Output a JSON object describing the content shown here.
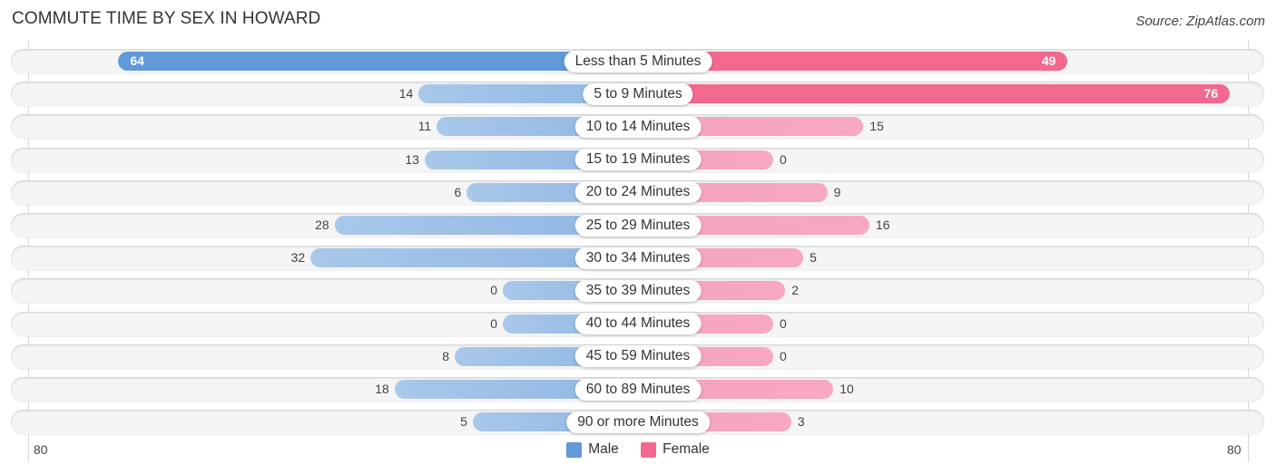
{
  "title": "COMMUTE TIME BY SEX IN HOWARD",
  "source": "Source: ZipAtlas.com",
  "colors": {
    "male": "#6199d9",
    "female": "#f2688f"
  },
  "chart_data": {
    "type": "bar",
    "orientation": "horizontal-diverging",
    "title": "COMMUTE TIME BY SEX IN HOWARD",
    "categories": [
      "Less than 5 Minutes",
      "5 to 9 Minutes",
      "10 to 14 Minutes",
      "15 to 19 Minutes",
      "20 to 24 Minutes",
      "25 to 29 Minutes",
      "30 to 34 Minutes",
      "35 to 39 Minutes",
      "40 to 44 Minutes",
      "45 to 59 Minutes",
      "60 to 89 Minutes",
      "90 or more Minutes"
    ],
    "series": [
      {
        "name": "Male",
        "values": [
          64,
          14,
          11,
          13,
          6,
          28,
          32,
          0,
          0,
          8,
          18,
          5
        ]
      },
      {
        "name": "Female",
        "values": [
          49,
          76,
          15,
          0,
          9,
          16,
          5,
          2,
          0,
          0,
          10,
          3
        ]
      }
    ],
    "axis": {
      "left_label": "80",
      "right_label": "80",
      "range": [
        -80,
        80
      ]
    },
    "legend": {
      "position": "bottom-center",
      "entries": [
        "Male",
        "Female"
      ]
    },
    "xlabel": "",
    "ylabel": ""
  }
}
